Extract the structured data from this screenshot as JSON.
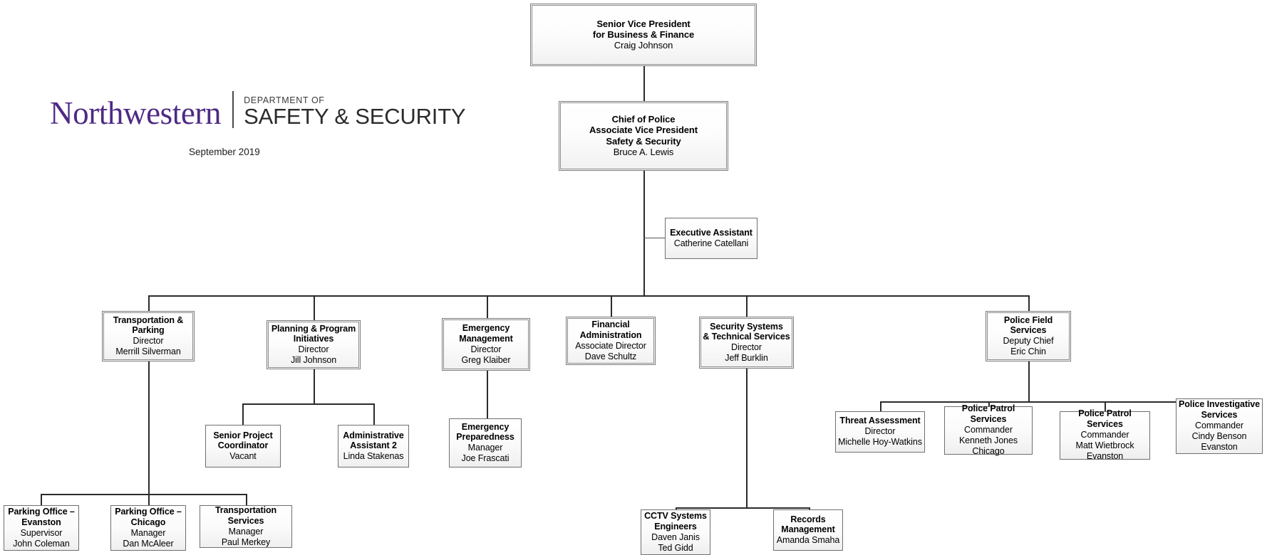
{
  "branding": {
    "wordmark": "Northwestern",
    "department_label": "DEPARTMENT OF",
    "unit_label": "SAFETY & SECURITY",
    "purple": "#4E2A84",
    "date": "September 2019"
  },
  "nodes": {
    "svp": {
      "title": "Senior Vice President\nfor Business & Finance",
      "detail": "Craig Johnson"
    },
    "chief": {
      "title": "Chief of Police\nAssociate Vice President\nSafety & Security",
      "detail": "Bruce A. Lewis"
    },
    "exec_assistant": {
      "title": "Executive Assistant",
      "detail": "Catherine Catellani"
    },
    "transportation_parking": {
      "title": "Transportation &\nParking",
      "detail": "Director\nMerrill Silverman"
    },
    "planning_program": {
      "title": "Planning & Program\nInitiatives",
      "detail": "Director\nJill Johnson"
    },
    "emergency_management": {
      "title": "Emergency\nManagement",
      "detail": "Director\nGreg Klaiber"
    },
    "financial_administration": {
      "title": "Financial\nAdministration",
      "detail": "Associate Director\nDave Schultz"
    },
    "security_systems": {
      "title": "Security Systems\n& Technical Services",
      "detail": "Director\nJeff Burklin"
    },
    "police_field_services": {
      "title": "Police Field Services",
      "detail": "Deputy Chief\nEric Chin"
    },
    "senior_project_coordinator": {
      "title": "Senior Project\nCoordinator",
      "detail": "Vacant"
    },
    "administrative_assistant": {
      "title": "Administrative\nAssistant 2",
      "detail": "Linda Stakenas"
    },
    "emergency_preparedness": {
      "title": "Emergency\nPreparedness",
      "detail": "Manager\nJoe Frascati"
    },
    "threat_assessment": {
      "title": "Threat Assessment",
      "detail": "Director\nMichelle Hoy-Watkins"
    },
    "police_patrol_chicago": {
      "title": "Police Patrol Services",
      "detail": "Commander\nKenneth Jones\nChicago"
    },
    "police_patrol_evanston": {
      "title": "Police Patrol Services",
      "detail": "Commander\nMatt Wietbrock\nEvanston"
    },
    "police_investigative": {
      "title": "Police Investigative\nServices",
      "detail": "Commander\nCindy Benson\nEvanston"
    },
    "parking_office_evanston": {
      "title": "Parking Office –\nEvanston",
      "detail": "Supervisor\nJohn Coleman"
    },
    "parking_office_chicago": {
      "title": "Parking Office –\nChicago",
      "detail": "Manager\nDan McAleer"
    },
    "transportation_services": {
      "title": "Transportation Services",
      "detail": "Manager\nPaul Merkey"
    },
    "cctv_systems": {
      "title": "CCTV Systems\nEngineers",
      "detail": "Daven Janis\nTed Gidd"
    },
    "records_management": {
      "title": "Records\nManagement",
      "detail": "Amanda Smaha"
    }
  }
}
